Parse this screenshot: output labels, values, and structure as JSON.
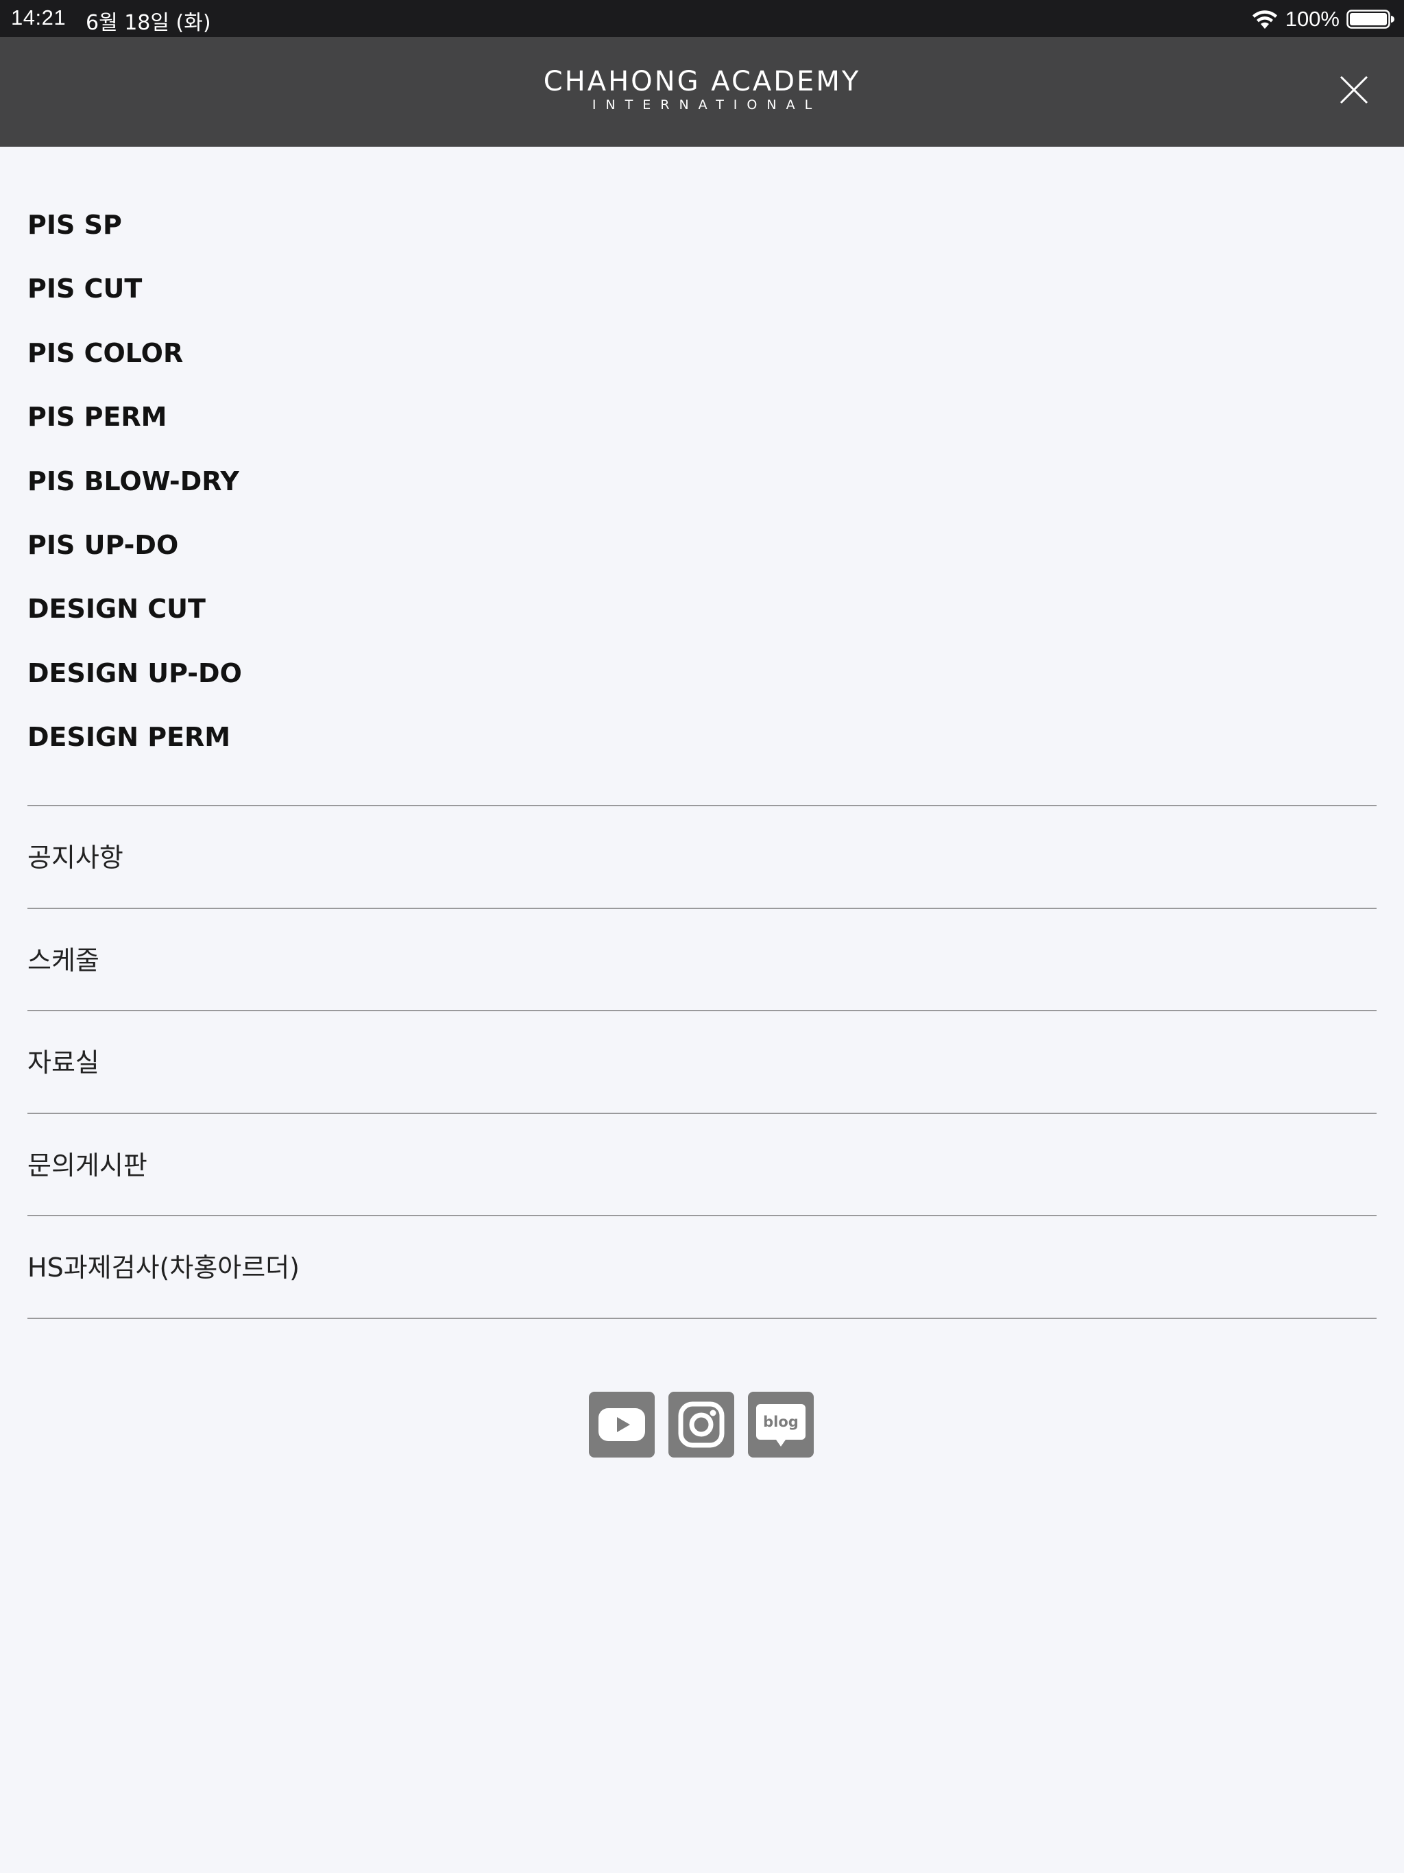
{
  "status_bar": {
    "time": "14:21",
    "date": "6월 18일 (화)",
    "battery": "100%"
  },
  "header": {
    "logo_main": "CHAHONG ACADEMY",
    "logo_sub": "INTERNATIONAL",
    "close_icon": "close-icon"
  },
  "menu": {
    "items": [
      {
        "label": "PIS SP"
      },
      {
        "label": "PIS CUT"
      },
      {
        "label": "PIS COLOR"
      },
      {
        "label": "PIS PERM"
      },
      {
        "label": "PIS BLOW-DRY"
      },
      {
        "label": "PIS UP-DO"
      },
      {
        "label": "DESIGN CUT"
      },
      {
        "label": "DESIGN UP-DO"
      },
      {
        "label": "DESIGN PERM"
      }
    ]
  },
  "boards": {
    "items": [
      {
        "label": "공지사항"
      },
      {
        "label": "스케줄"
      },
      {
        "label": "자료실"
      },
      {
        "label": "문의게시판"
      },
      {
        "label": "HS과제검사(차홍아르더)"
      }
    ]
  },
  "sns": {
    "icons": [
      "youtube-icon",
      "instagram-icon",
      "blog-icon"
    ],
    "blog_text": "blog",
    "icon_bg": "#7c7c7c"
  },
  "colors": {
    "status_bar_bg": "#1b1b1d",
    "header_bg": "#444445",
    "page_bg": "#f5f6fa",
    "divider": "#9a9a9c"
  }
}
